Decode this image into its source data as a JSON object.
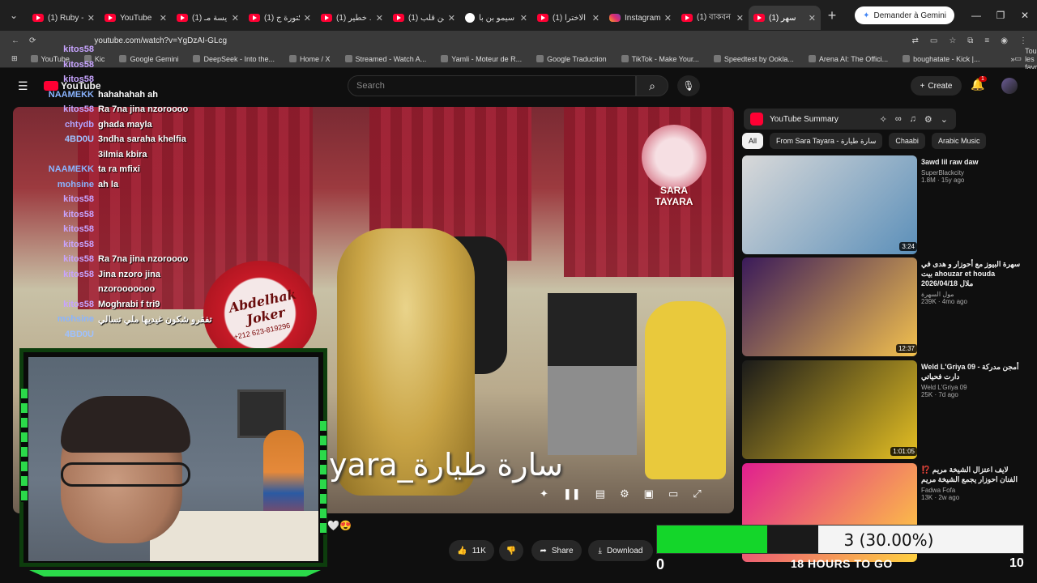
{
  "tabs": [
    {
      "label": "(1) Ruby - ه",
      "type": "yt",
      "active": false
    },
    {
      "label": "YouTube",
      "type": "yt",
      "active": false
    },
    {
      "label": "(1) مايسة مـ",
      "type": "yt",
      "active": false
    },
    {
      "label": "(1) دكتورة ج",
      "type": "yt",
      "active": false
    },
    {
      "label": "(1) خطير ...",
      "type": "yt",
      "active": false
    },
    {
      "label": "(1) من قلب",
      "type": "yt",
      "active": false
    },
    {
      "label": "سيمو بن با",
      "type": "g",
      "active": false
    },
    {
      "label": "(1) الاخترا",
      "type": "yt",
      "active": false
    },
    {
      "label": "Instagram",
      "type": "ig",
      "active": false
    },
    {
      "label": "(1) বাকবন ফিট",
      "type": "yt",
      "active": false
    },
    {
      "label": "(1) سهر",
      "type": "yt",
      "active": true
    }
  ],
  "browser": {
    "gemini_label": "Demander à Gemini",
    "url": "youtube.com/watch?v=YgDzAI-GLcg",
    "all_bookmarks": "Tous les favoris"
  },
  "bookmarks": [
    "YouTube",
    "Kic",
    "Google Gemini",
    "DeepSeek - Into the...",
    "Home / X",
    "Streamed - Watch A...",
    "Yamli - Moteur de R...",
    "Google Traduction",
    "TikTok - Make Your...",
    "Speedtest by Ookla...",
    "Arena AI: The Offici...",
    "boughatate - Kick |..."
  ],
  "yt": {
    "logo": "YouTube",
    "search_placeholder": "Search",
    "create_label": "Create",
    "notif_count": "1"
  },
  "chat": [
    {
      "user": "kitos58",
      "msg": "",
      "color": "#c7a4ff"
    },
    {
      "user": "kitos58",
      "msg": "",
      "color": "#c7a4ff"
    },
    {
      "user": "kitos58",
      "msg": "",
      "color": "#c7a4ff"
    },
    {
      "user": "NAAMEKK",
      "msg": "hahahahah ah",
      "color": "#8ab4ff"
    },
    {
      "user": "kitos58",
      "msg": "Ra 7na jina nzoroooo",
      "color": "#c7a4ff"
    },
    {
      "user": "chtydb",
      "msg": "ghada mayla",
      "color": "#b2a4ff"
    },
    {
      "user": "4BD0U",
      "msg": "3ndha saraha khelfia",
      "color": "#9ec1ff"
    },
    {
      "user": "",
      "msg": "3ilmia kbira",
      "color": "#9ec1ff"
    },
    {
      "user": "NAAMEKK",
      "msg": "ta ra mfixi",
      "color": "#8ab4ff"
    },
    {
      "user": "mohsine",
      "msg": "ah la",
      "color": "#8ab4ff"
    },
    {
      "user": "kitos58",
      "msg": "",
      "color": "#c7a4ff"
    },
    {
      "user": "kitos58",
      "msg": "",
      "color": "#c7a4ff"
    },
    {
      "user": "kitos58",
      "msg": "",
      "color": "#c7a4ff"
    },
    {
      "user": "kitos58",
      "msg": "",
      "color": "#c7a4ff"
    },
    {
      "user": "kitos58",
      "msg": "Ra 7na jina nzoroooo",
      "color": "#c7a4ff"
    },
    {
      "user": "kitos58",
      "msg": "Jina nzoro jina",
      "color": "#c7a4ff"
    },
    {
      "user": "",
      "msg": "nzorooooooo",
      "color": "#c7a4ff"
    },
    {
      "user": "kitos58",
      "msg": "Moghrabi f tri9",
      "color": "#c7a4ff"
    },
    {
      "user": "mohsine",
      "msg": "تفقرو شكون غيديها ملي تسالي",
      "color": "#8ab4ff"
    },
    {
      "user": "4BD0U",
      "msg": "",
      "color": "#9ec1ff"
    }
  ],
  "video": {
    "drum_text": "Abdelhak Joker",
    "drum_phone": "+212 623-819296",
    "watermark": "SARA TAYARA",
    "caption": "yara_سارة طيارة"
  },
  "actions": {
    "likes": "11K",
    "share": "Share",
    "download": "Download"
  },
  "summary": {
    "label": "YouTube Summary"
  },
  "chips": [
    "All",
    "From Sara Tayara - سارة طيارة",
    "Chaabi",
    "Arabic Music"
  ],
  "recs": [
    {
      "title": "3awd lil raw daw",
      "channel": "SuperBlackcity",
      "meta": "1.8M · 15y ago",
      "duration": "3:24",
      "thumb": [
        "#d9d9d9",
        "#5b8fb9"
      ]
    },
    {
      "title": "سهرة البيوز مع أحوزار و هدى في بيت ahouzar et houda 2026/04/18 ملال",
      "channel": "مول السهرة",
      "meta": "239K · 4mo ago",
      "duration": "12:37",
      "thumb": [
        "#3a1a5a",
        "#f2c14e"
      ]
    },
    {
      "title": "Weld L'Griya 09 - أمجن مدركة دارت فحياتي",
      "channel": "Weld L'Griya 09",
      "meta": "25K · 7d ago",
      "duration": "1:01:05",
      "thumb": [
        "#1a1a1a",
        "#e5c023"
      ]
    },
    {
      "title": "لايف اعتزال الشيخة مريم ⁉️ الفنان احوزار يجمع الشيخة مريم",
      "channel": "Fadwa Fofa",
      "meta": "13K · 2w ago",
      "duration": "",
      "thumb": [
        "#e01e8f",
        "#ffd23f"
      ]
    }
  ],
  "goal": {
    "label": "3 (30.00%)",
    "progress": 0.3,
    "start": "0",
    "end": "10",
    "time_left": "18 HOURS TO GO"
  },
  "colors": {
    "accent_green": "#14d62a",
    "yt_red": "#ff0033"
  }
}
